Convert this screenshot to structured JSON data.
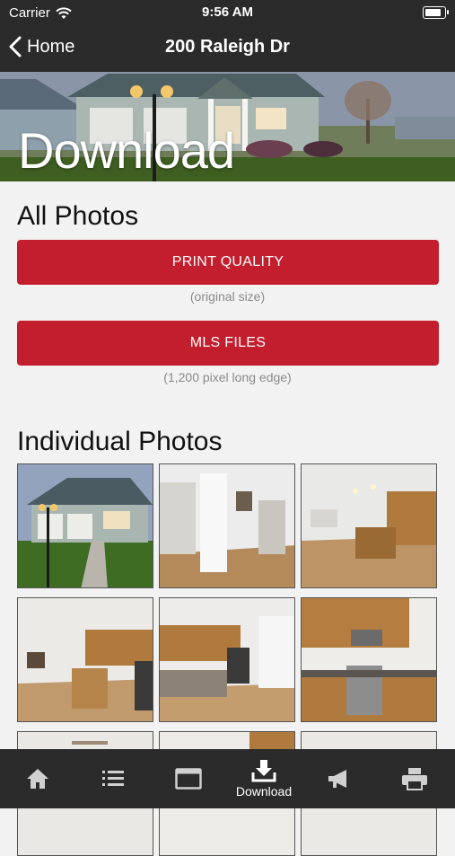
{
  "status_bar": {
    "carrier": "Carrier",
    "time": "9:56 AM"
  },
  "nav": {
    "back_label": "Home",
    "title": "200 Raleigh Dr"
  },
  "hero": {
    "heading": "Download"
  },
  "all_photos": {
    "title": "All Photos",
    "buttons": [
      {
        "label": "PRINT QUALITY",
        "note": "(original size)"
      },
      {
        "label": "MLS FILES",
        "note": "(1,200 pixel long edge)"
      }
    ]
  },
  "individual_photos": {
    "title": "Individual Photos",
    "photos": [
      "exterior-front",
      "living-room-hallway",
      "open-kitchen-living",
      "kitchen-island-view",
      "kitchen-dining-view",
      "kitchen-range"
    ]
  },
  "tab_bar": {
    "tabs": [
      {
        "icon": "home-icon",
        "label": ""
      },
      {
        "icon": "list-icon",
        "label": ""
      },
      {
        "icon": "browser-window-icon",
        "label": ""
      },
      {
        "icon": "download-icon",
        "label": "Download",
        "active": true
      },
      {
        "icon": "megaphone-icon",
        "label": ""
      },
      {
        "icon": "printer-icon",
        "label": ""
      }
    ]
  },
  "colors": {
    "accent": "#c21e2d",
    "bar": "#2b2b2b",
    "background": "#f2f2f2"
  }
}
